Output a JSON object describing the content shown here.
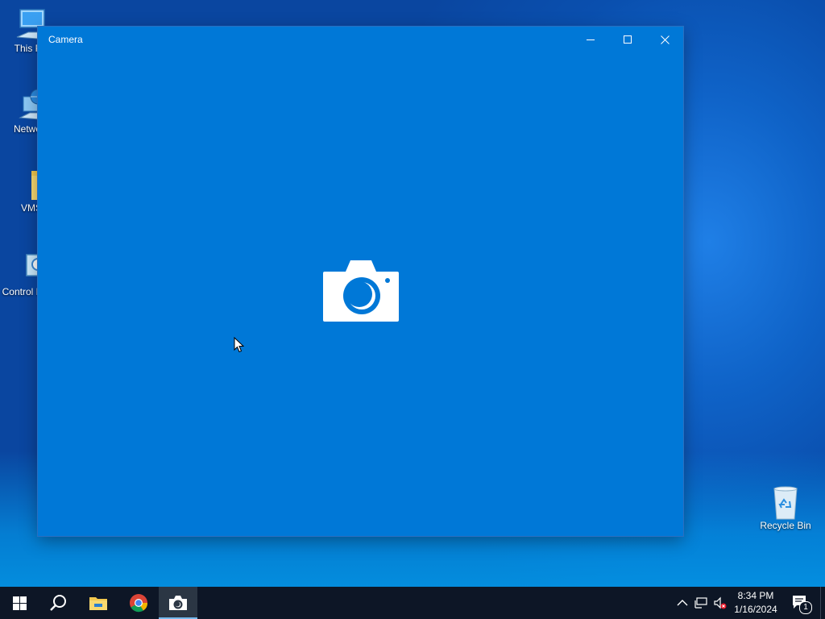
{
  "desktop": {
    "icons": [
      {
        "label": "This PC"
      },
      {
        "label": "Network"
      },
      {
        "label": "VMS"
      },
      {
        "label": "Control Panel"
      },
      {
        "label": "Recycle Bin"
      }
    ]
  },
  "window": {
    "title": "Camera",
    "controls": {
      "minimize": "minimize-icon",
      "maximize": "maximize-icon",
      "close": "close-icon"
    },
    "accent": "#0078d7",
    "placeholder_icon": "camera-icon"
  },
  "taskbar": {
    "apps": [
      "start-icon",
      "search-icon",
      "file-explorer-icon",
      "chrome-icon",
      "camera-icon"
    ],
    "active_app": "camera",
    "tray": [
      "chevron-up-icon",
      "network-icon",
      "volume-muted-icon"
    ],
    "time": "8:34 PM",
    "date": "1/16/2024",
    "notifications_count": "1"
  }
}
